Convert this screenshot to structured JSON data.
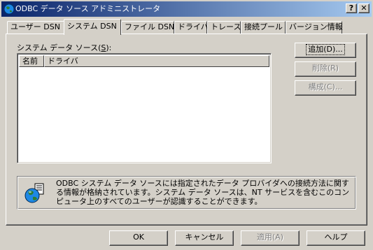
{
  "window": {
    "title": "ODBC データ ソース アドミニストレータ",
    "help_button": "?",
    "close_button": "✕"
  },
  "tabs": [
    {
      "label": "ユーザー DSN"
    },
    {
      "label": "システム DSN"
    },
    {
      "label": "ファイル DSN"
    },
    {
      "label": "ドライバ"
    },
    {
      "label": "トレース"
    },
    {
      "label": "接続プール"
    },
    {
      "label": "バージョン情報"
    }
  ],
  "active_tab": "システム DSN",
  "system_dsn": {
    "section_label_prefix": "システム データ ソース(",
    "section_label_key": "S",
    "section_label_suffix": "):",
    "columns": [
      "名前",
      "ドライバ"
    ],
    "rows": [],
    "add_button": "追加(D)...",
    "remove_button": "削除(R)",
    "configure_button": "構成(C)...",
    "info_text": "ODBC システム データ ソースには指定されたデータ プロバイダへの接続方法に関する情報が格納されています。システム データ ソースは、NT サービスを含むこのコンピュータ上のすべてのユーザーが認識することができます。"
  },
  "footer": {
    "ok_button": "OK",
    "cancel_button": "キャンセル",
    "apply_button": "適用(A)",
    "help_button": "ヘルプ"
  },
  "colors": {
    "titlebar_start": "#0a246a",
    "titlebar_end": "#a6caf0",
    "face": "#d4d0c8"
  }
}
